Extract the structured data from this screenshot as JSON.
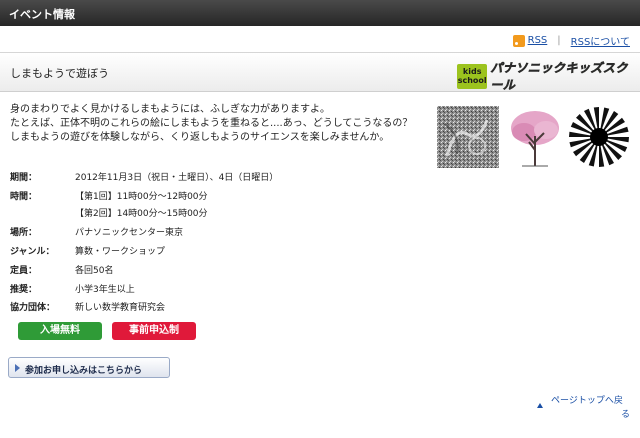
{
  "header": {
    "title": "イベント情報"
  },
  "rss": {
    "link": "RSS",
    "about": "RSSについて"
  },
  "page": {
    "title": "しまもようで遊ぼう"
  },
  "logo": {
    "badge_line1": "kids",
    "badge_line2": "school",
    "text": "パナソニックキッズスクール"
  },
  "intro": [
    "身のまわりでよく見かけるしまもようには、ふしぎな力がありますよ。",
    "たとえば、正体不明のこれらの絵にしまもようを重ねると....あっ、どうしてこうなるの？",
    "しまもようの遊びを体験しながら、くり返しもようのサイエンスを楽しみませんか。"
  ],
  "details": [
    {
      "label": "期間：",
      "value": "2012年11月3日（祝日・土曜日）、4日（日曜日）"
    },
    {
      "label": "時間：",
      "value": "【第1回】11時00分～12時00分"
    },
    {
      "label": "",
      "value": "【第2回】14時00分～15時00分"
    },
    {
      "label": "場所：",
      "value": "パナソニックセンター東京"
    },
    {
      "label": "ジャンル：",
      "value": "算数・ワークショップ"
    },
    {
      "label": "定員：",
      "value": "各回50名"
    },
    {
      "label": "推奨：",
      "value": "小学3年生以上"
    },
    {
      "label": "協力団体：",
      "value": "新しい数学教育研究会"
    }
  ],
  "badges": {
    "free": "入場無料",
    "registration": "事前申込制"
  },
  "apply": {
    "label": "参加お申し込みはこちらから"
  },
  "pagetop": {
    "line1": "ページトップへ戻",
    "line2": "る"
  },
  "colors": {
    "header_bg": "#333333",
    "link": "#1a4fa5",
    "logo_green": "#9cc31e",
    "badge_green": "#2f9b37",
    "badge_red": "#e0193a"
  }
}
